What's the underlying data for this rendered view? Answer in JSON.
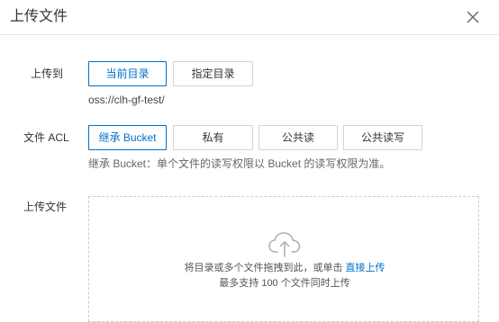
{
  "dialog": {
    "title": "上传文件",
    "close_icon": "close-icon"
  },
  "upload_to": {
    "label": "上传到",
    "options": [
      "当前目录",
      "指定目录"
    ],
    "selected": "当前目录",
    "path": "oss://clh-gf-test/"
  },
  "acl": {
    "label": "文件 ACL",
    "options": [
      "继承 Bucket",
      "私有",
      "公共读",
      "公共读写"
    ],
    "selected": "继承 Bucket",
    "hint": "继承 Bucket：单个文件的读写权限以 Bucket 的读写权限为准。"
  },
  "upload_file": {
    "label": "上传文件",
    "icon": "cloud-upload-icon",
    "drop_text": "将目录或多个文件拖拽到此，或单击",
    "link_text": "直接上传",
    "limit_text": "最多支持 100 个文件同时上传"
  },
  "colors": {
    "accent": "#0070cc",
    "border": "#d0d4da"
  }
}
